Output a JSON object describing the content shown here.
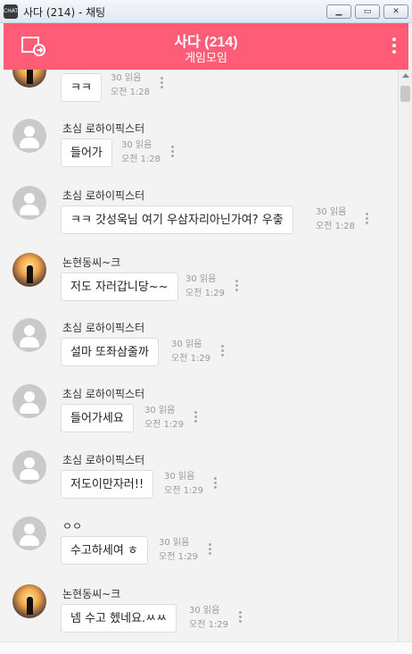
{
  "window": {
    "title": "사다 (214) - 채팅",
    "app_icon_text": "CHAT",
    "min_label": "▁",
    "max_label": "▭",
    "close_label": "✕"
  },
  "header": {
    "title": "사다 (214)",
    "subtitle": "게임모임",
    "accent_color": "#ff5c77"
  },
  "messages": [
    {
      "sender": "",
      "text": "ㅋㅋ",
      "reads": "30 읽음",
      "time": "오전 1:28",
      "avatar": "photo"
    },
    {
      "sender": "초심 로하이픽스터",
      "text": "들어가",
      "reads": "30 읽음",
      "time": "오전 1:28",
      "avatar": "default"
    },
    {
      "sender": "초심 로하이픽스터",
      "text": "ㅋㅋ 갓성욱님 여기 우삼자리아닌가여? 우춯",
      "reads": "30 읽음",
      "time": "오전 1:28",
      "avatar": "default"
    },
    {
      "sender": "논현동씨~크",
      "text": "저도 자러갑니당~~",
      "reads": "30 읽음",
      "time": "오전 1:29",
      "avatar": "photo"
    },
    {
      "sender": "초심 로하이픽스터",
      "text": "설마 또좌삼줄까",
      "reads": "30 읽음",
      "time": "오전 1:29",
      "avatar": "default"
    },
    {
      "sender": "초심 로하이픽스터",
      "text": "들어가세요",
      "reads": "30 읽음",
      "time": "오전 1:29",
      "avatar": "default"
    },
    {
      "sender": "초심 로하이픽스터",
      "text": "저도이만자러!!",
      "reads": "30 읽음",
      "time": "오전 1:29",
      "avatar": "default"
    },
    {
      "sender": "ㅇㅇ",
      "text": "수고하세여 ㅎ",
      "reads": "30 읽음",
      "time": "오전 1:29",
      "avatar": "default"
    },
    {
      "sender": "논현동씨~크",
      "text": "넴 수고 헸네요.ㅆㅆ",
      "reads": "30 읽음",
      "time": "오전 1:29",
      "avatar": "photo"
    }
  ]
}
